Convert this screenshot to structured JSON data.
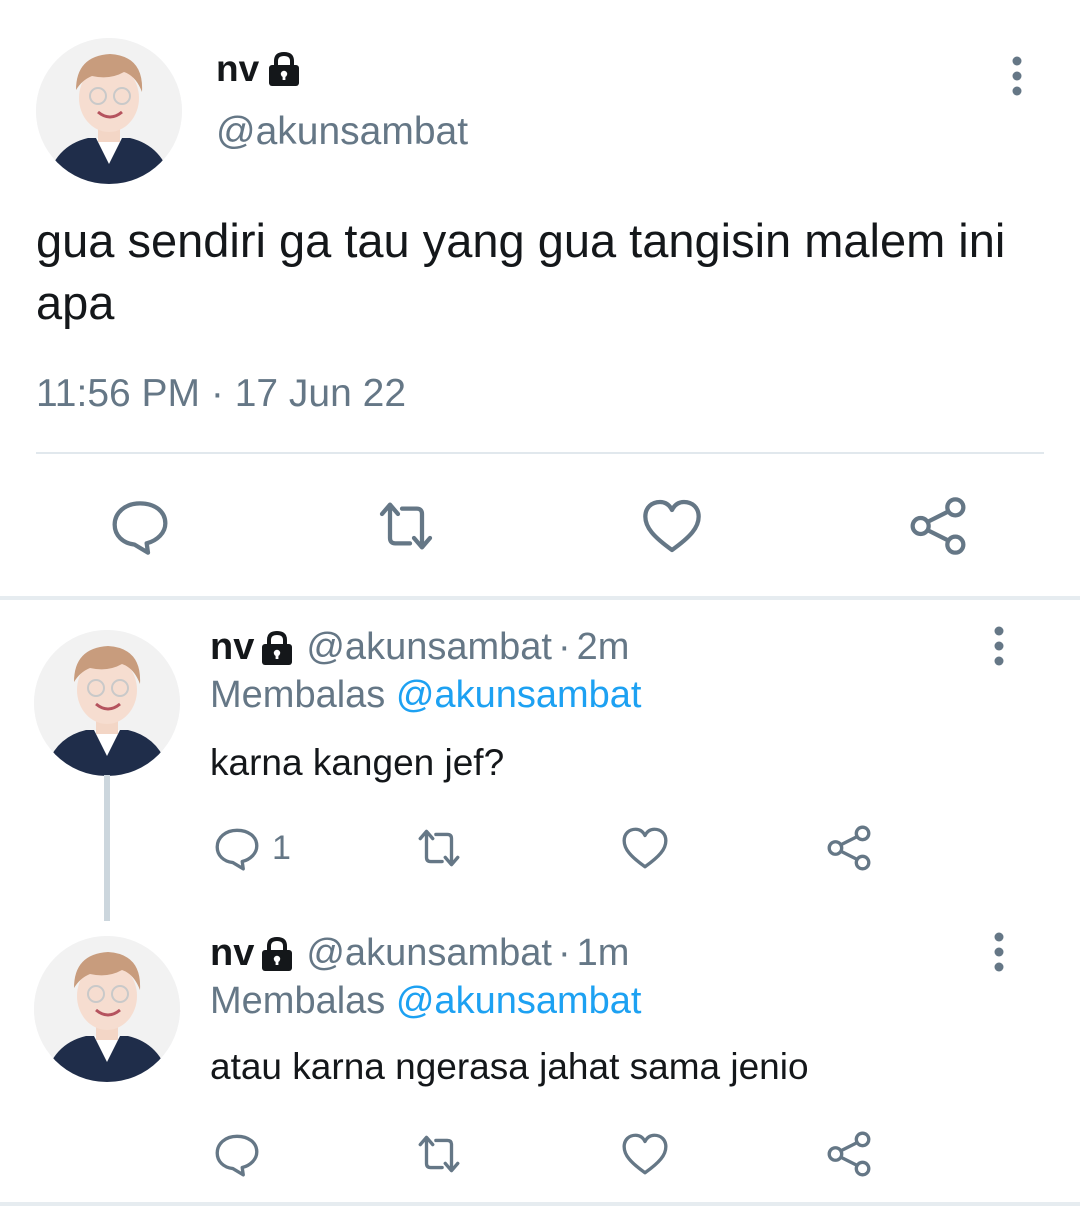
{
  "main_tweet": {
    "display_name": "nv",
    "handle": "@akunsambat",
    "text": "gua sendiri ga tau yang gua tangisin malem ini apa",
    "timestamp": "11:56 PM · 17 Jun 22",
    "actions": [
      "reply-icon",
      "retweet-icon",
      "like-icon",
      "share-icon"
    ]
  },
  "replies": [
    {
      "display_name": "nv",
      "handle": "@akunsambat",
      "dot": "·",
      "time": "2m",
      "replying_prefix": "Membalas",
      "replying_to": "@akunsambat",
      "text": "karna kangen jef?",
      "reply_count": "1"
    },
    {
      "display_name": "nv",
      "handle": "@akunsambat",
      "dot": "·",
      "time": "1m",
      "replying_prefix": "Membalas",
      "replying_to": "@akunsambat",
      "text": "atau karna ngerasa jahat sama jenio",
      "reply_count": ""
    }
  ],
  "colors": {
    "text": "#14171a",
    "secondary": "#657786",
    "mention": "#1da1f2",
    "divider": "#e1e8ed",
    "thread_line": "#ccd6dd"
  }
}
